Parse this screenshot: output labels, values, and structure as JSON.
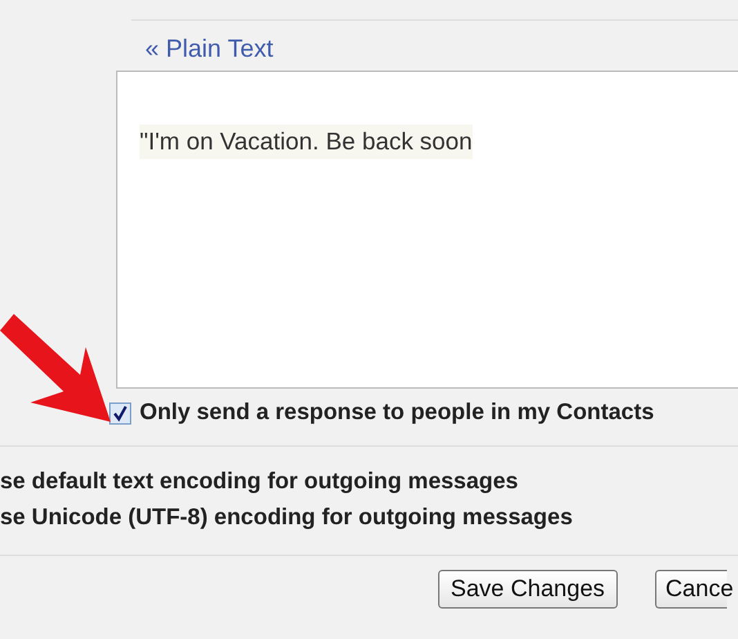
{
  "format_link": "« Plain Text",
  "message": {
    "value": "\"I'm on Vacation. Be back soon"
  },
  "contacts_only": {
    "label": "Only send a response to people in my Contacts",
    "checked": true
  },
  "encoding_options": [
    {
      "label": "se default text encoding for outgoing messages"
    },
    {
      "label": "se Unicode (UTF-8) encoding for outgoing messages"
    }
  ],
  "buttons": [
    {
      "label": "Save Changes"
    },
    {
      "label": "Cance"
    }
  ]
}
